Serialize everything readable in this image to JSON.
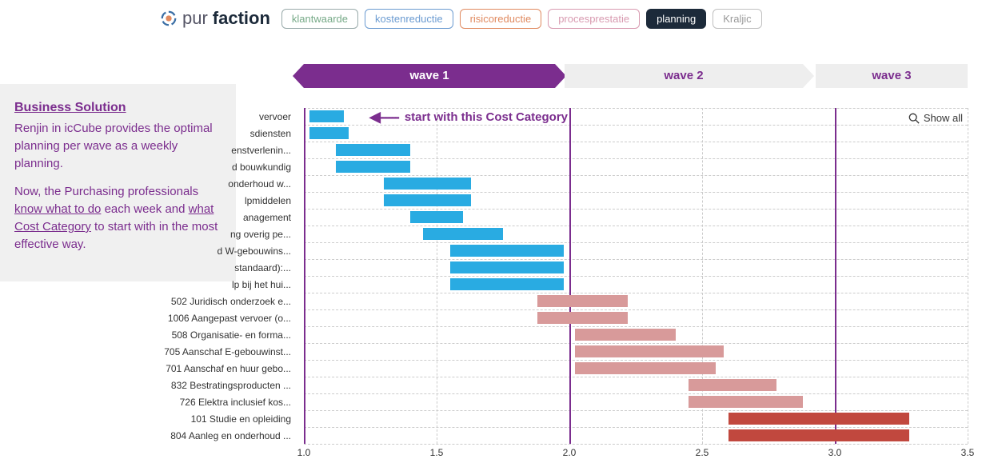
{
  "logo_text_plain": "pur",
  "logo_text_bold": "faction",
  "nav": {
    "klantwaarde": "klantwaarde",
    "kosten": "kostenreductie",
    "risico": "risicoreductie",
    "proces": "procesprestatie",
    "planning": "planning",
    "kraljic": "Kraljic"
  },
  "waves": {
    "w1": "wave 1",
    "w2": "wave 2",
    "w3": "wave 3"
  },
  "annotation": "start with this Cost Category",
  "showall": "Show all",
  "callout": {
    "title": "Business Solution",
    "p1a": "Renjin in icCube provides the optimal planning per wave as a weekly planning.",
    "p2a": "Now, the Purchasing professionals ",
    "p2u1": "know what to do",
    "p2b": " each week and ",
    "p2u2": "what Cost Category",
    "p2c": " to start with in the most effective way."
  },
  "chart_data": {
    "type": "bar",
    "orientation": "horizontal-range",
    "xlabel": "",
    "ylabel": "",
    "xlim": [
      1.0,
      3.5
    ],
    "xticks": [
      1.0,
      1.5,
      2.0,
      2.5,
      3.0,
      3.5
    ],
    "wave_boundaries": [
      1.0,
      2.0,
      3.0
    ],
    "categories": [
      "vervoer",
      "sdiensten",
      "enstverlenin...",
      "d bouwkundig",
      "onderhoud w...",
      "lpmiddelen",
      "anagement",
      "ng overig pe...",
      "d W-gebouwins...",
      "standaard):...",
      "lp bij het hui...",
      "502 Juridisch onderzoek e...",
      "1006 Aangepast vervoer (o...",
      "508 Organisatie- en forma...",
      "705 Aanschaf E-gebouwinst...",
      "701 Aanschaf en huur gebo...",
      "832 Bestratingsproducten ...",
      "726 Elektra inclusief kos...",
      "101 Studie en opleiding",
      "804 Aanleg en onderhoud ..."
    ],
    "series": [
      {
        "name": "wave 1",
        "color": "#29abe2"
      },
      {
        "name": "wave 2",
        "color": "#d89a9a"
      },
      {
        "name": "wave 3",
        "color": "#c1483e"
      }
    ],
    "bars": [
      {
        "row": 0,
        "start": 1.02,
        "end": 1.15,
        "series": 0
      },
      {
        "row": 1,
        "start": 1.02,
        "end": 1.17,
        "series": 0
      },
      {
        "row": 2,
        "start": 1.12,
        "end": 1.4,
        "series": 0
      },
      {
        "row": 3,
        "start": 1.12,
        "end": 1.4,
        "series": 0
      },
      {
        "row": 4,
        "start": 1.3,
        "end": 1.63,
        "series": 0
      },
      {
        "row": 5,
        "start": 1.3,
        "end": 1.63,
        "series": 0
      },
      {
        "row": 6,
        "start": 1.4,
        "end": 1.6,
        "series": 0
      },
      {
        "row": 7,
        "start": 1.45,
        "end": 1.75,
        "series": 0
      },
      {
        "row": 8,
        "start": 1.55,
        "end": 1.98,
        "series": 0
      },
      {
        "row": 9,
        "start": 1.55,
        "end": 1.98,
        "series": 0
      },
      {
        "row": 10,
        "start": 1.55,
        "end": 1.98,
        "series": 0
      },
      {
        "row": 11,
        "start": 1.88,
        "end": 2.22,
        "series": 1
      },
      {
        "row": 12,
        "start": 1.88,
        "end": 2.22,
        "series": 1
      },
      {
        "row": 13,
        "start": 2.02,
        "end": 2.4,
        "series": 1
      },
      {
        "row": 14,
        "start": 2.02,
        "end": 2.58,
        "series": 1
      },
      {
        "row": 15,
        "start": 2.02,
        "end": 2.55,
        "series": 1
      },
      {
        "row": 16,
        "start": 2.45,
        "end": 2.78,
        "series": 1
      },
      {
        "row": 17,
        "start": 2.45,
        "end": 2.88,
        "series": 1
      },
      {
        "row": 18,
        "start": 2.6,
        "end": 3.28,
        "series": 2
      },
      {
        "row": 19,
        "start": 2.6,
        "end": 3.28,
        "series": 2
      }
    ]
  }
}
